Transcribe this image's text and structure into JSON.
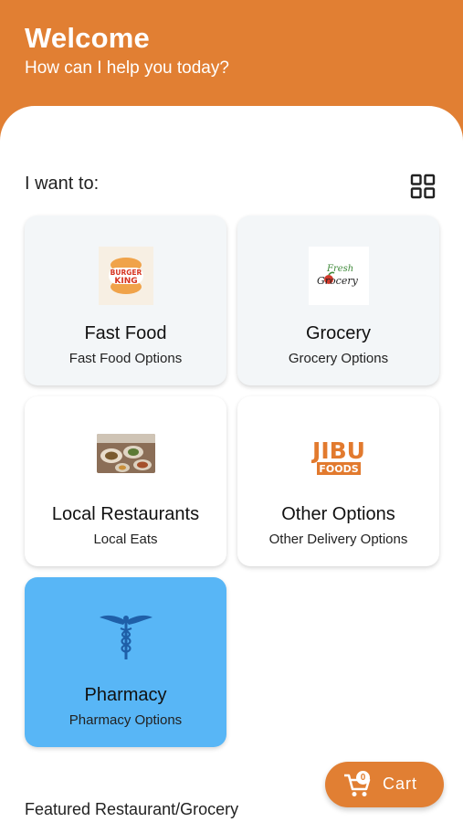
{
  "header": {
    "title": "Welcome",
    "subtitle": "How can I help you today?"
  },
  "section": {
    "label": "I want to:"
  },
  "categories": [
    {
      "title": "Fast Food",
      "subtitle": "Fast Food Options",
      "logo_text": [
        "BURGER",
        "KING"
      ]
    },
    {
      "title": "Grocery",
      "subtitle": "Grocery Options",
      "logo_text": [
        "Fresh",
        "Grocery"
      ]
    },
    {
      "title": "Local Restaurants",
      "subtitle": "Local Eats"
    },
    {
      "title": "Other Options",
      "subtitle": "Other Delivery Options",
      "logo_text": [
        "JIBU",
        "FOODS"
      ]
    },
    {
      "title": "Pharmacy",
      "subtitle": "Pharmacy Options"
    }
  ],
  "featured": {
    "label": "Featured Restaurant/Grocery"
  },
  "cart": {
    "label": "Cart",
    "count": "0"
  },
  "colors": {
    "brand": "#e17f33",
    "pharmacy": "#58b6f6",
    "card": "#f3f6f8"
  },
  "icons": {
    "view_toggle": "grid-view-icon",
    "cart": "cart-icon"
  }
}
